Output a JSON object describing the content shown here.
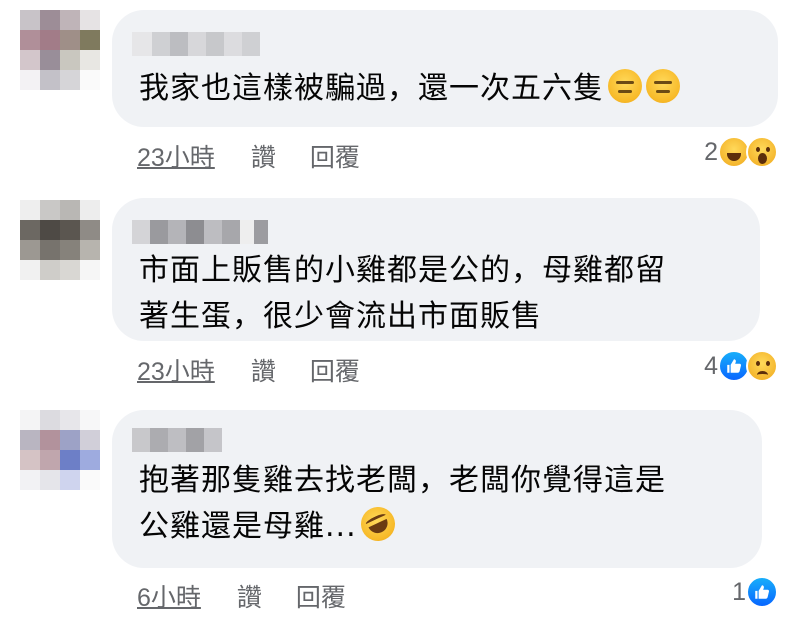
{
  "colors": {
    "bubble_bg": "#f0f2f5",
    "meta_text": "#65676b",
    "like_blue": "#0866ff"
  },
  "actions": {
    "like_label": "讚",
    "reply_label": "回覆"
  },
  "comments": [
    {
      "text_lines": [
        "我家也這樣被騙過，還一次五六隻"
      ],
      "trailing_emojis": [
        "expressionless-face-icon",
        "expressionless-face-icon"
      ],
      "time": "23小時",
      "reaction_count": "2",
      "reactions": [
        "haha-reaction-icon",
        "wow-reaction-icon"
      ]
    },
    {
      "text_lines": [
        "市面上販售的小雞都是公的，母雞都留",
        "著生蛋，很少會流出市面販售"
      ],
      "trailing_emojis": [],
      "time": "23小時",
      "reaction_count": "4",
      "reactions": [
        "like-reaction-icon",
        "sad-reaction-icon"
      ]
    },
    {
      "text_lines": [
        "抱著那隻雞去找老闆，老闆你覺得這是",
        "公雞還是母雞..."
      ],
      "trailing_emojis": [
        "rolling-on-floor-laughing-icon"
      ],
      "time": "6小時",
      "reaction_count": "1",
      "reactions": [
        "like-reaction-icon"
      ]
    }
  ]
}
